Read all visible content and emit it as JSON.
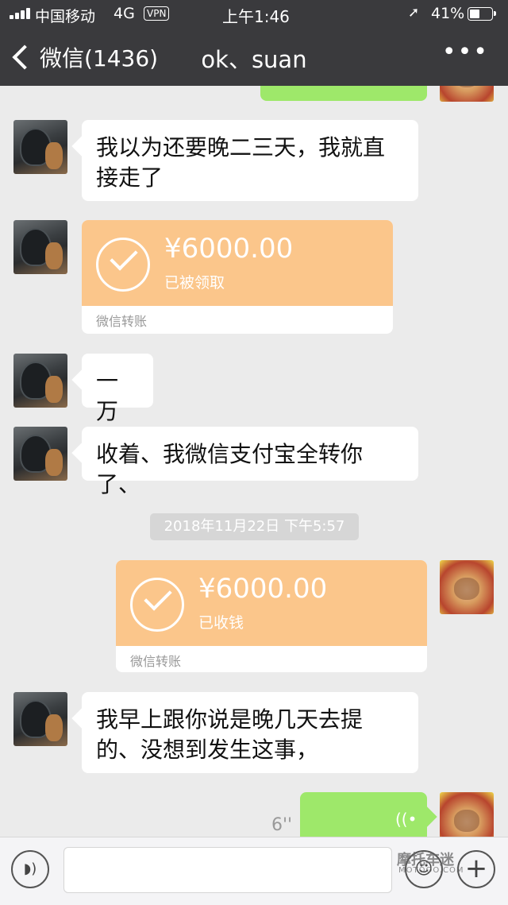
{
  "status_bar": {
    "carrier": "中国移动",
    "network": "4G",
    "vpn": "VPN",
    "time": "上午1:46",
    "battery": "41%",
    "icons": [
      "signal-icon",
      "location-arrow-icon",
      "battery-icon"
    ]
  },
  "nav": {
    "back_label": "微信(1436)",
    "title": "ok、suan",
    "more": "•••"
  },
  "messages": [
    {
      "side": "left",
      "type": "text",
      "text": "我以为还要晚二三天，我就直接走了"
    },
    {
      "side": "left",
      "type": "transfer",
      "amount": "¥6000.00",
      "status": "已被领取",
      "footer": "微信转账"
    },
    {
      "side": "left",
      "type": "text",
      "text": "一万"
    },
    {
      "side": "left",
      "type": "text",
      "text": "收着、我微信支付宝全转你了、"
    },
    {
      "type": "timestamp",
      "text": "2018年11月22日 下午5:57"
    },
    {
      "side": "right",
      "type": "transfer",
      "amount": "¥6000.00",
      "status": "已收钱",
      "footer": "微信转账"
    },
    {
      "side": "left",
      "type": "text",
      "text": "我早上跟你说是晚几天去提的、没想到发生这事，"
    },
    {
      "side": "right",
      "type": "voice",
      "duration": "6''"
    }
  ],
  "input_bar": {
    "icons": [
      "voice-icon",
      "emoji-icon",
      "plus-icon"
    ]
  },
  "watermark": {
    "line1": "摩托车迷",
    "line2": "MOTOOO.COM"
  },
  "colors": {
    "header_bg": "#3a3a3d",
    "chat_bg": "#ebebeb",
    "sent_bubble": "#9ee86a",
    "transfer_card": "#fbc68b"
  }
}
